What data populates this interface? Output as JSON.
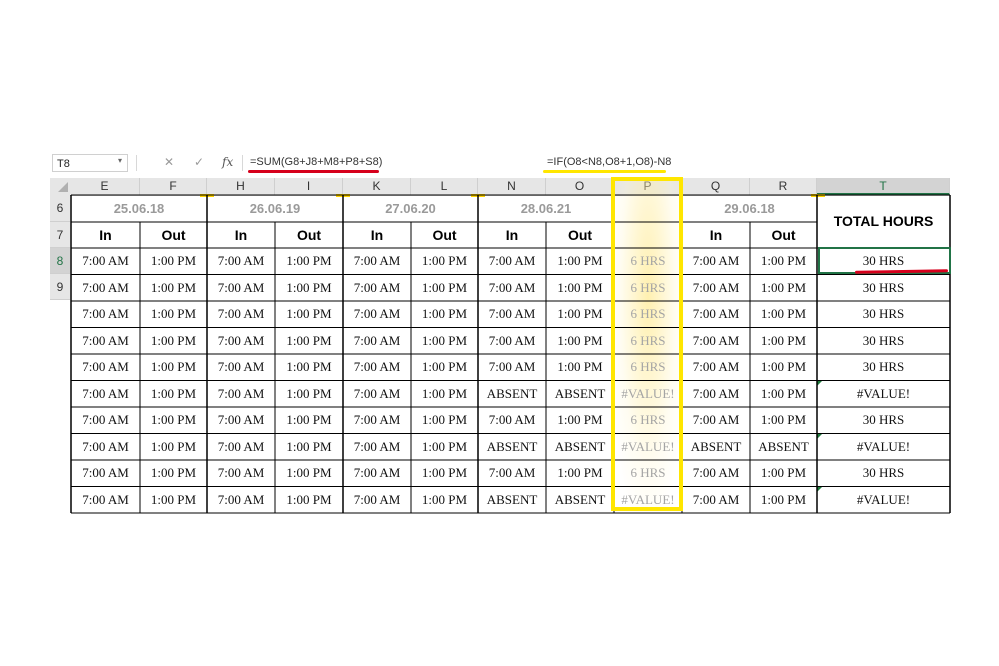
{
  "formula_bar": {
    "name_box": "T8",
    "dropdown_icon": "▾",
    "cancel_icon": "✕",
    "enter_icon": "✓",
    "fx_label": "fx",
    "formula_1": "=SUM(G8+J8+M8+P8+S8)",
    "formula_2": "=IF(O8<N8,O8+1,O8)-N8"
  },
  "column_letters": [
    "E",
    "F",
    "H",
    "I",
    "K",
    "L",
    "N",
    "O",
    "P",
    "Q",
    "R",
    "T"
  ],
  "row_numbers": [
    "6",
    "7",
    "8",
    "9"
  ],
  "dates": [
    "25.06.18",
    "26.06.19",
    "27.06.20",
    "28.06.21",
    "29.06.18"
  ],
  "in_label": "In",
  "out_label": "Out",
  "total_header": "TOTAL HOURS",
  "rows": [
    {
      "e": "7:00 AM",
      "f": "1:00 PM",
      "h": "7:00 AM",
      "i": "1:00 PM",
      "k": "7:00 AM",
      "l": "1:00 PM",
      "n": "7:00 AM",
      "o": "1:00 PM",
      "p": "6 HRS",
      "q": "7:00 AM",
      "r": "1:00 PM",
      "t": "30 HRS"
    },
    {
      "e": "7:00 AM",
      "f": "1:00 PM",
      "h": "7:00 AM",
      "i": "1:00 PM",
      "k": "7:00 AM",
      "l": "1:00 PM",
      "n": "7:00 AM",
      "o": "1:00 PM",
      "p": "6 HRS",
      "q": "7:00 AM",
      "r": "1:00 PM",
      "t": "30 HRS"
    },
    {
      "e": "7:00 AM",
      "f": "1:00 PM",
      "h": "7:00 AM",
      "i": "1:00 PM",
      "k": "7:00 AM",
      "l": "1:00 PM",
      "n": "7:00 AM",
      "o": "1:00 PM",
      "p": "6 HRS",
      "q": "7:00 AM",
      "r": "1:00 PM",
      "t": "30 HRS"
    },
    {
      "e": "7:00 AM",
      "f": "1:00 PM",
      "h": "7:00 AM",
      "i": "1:00 PM",
      "k": "7:00 AM",
      "l": "1:00 PM",
      "n": "7:00 AM",
      "o": "1:00 PM",
      "p": "6 HRS",
      "q": "7:00 AM",
      "r": "1:00 PM",
      "t": "30 HRS"
    },
    {
      "e": "7:00 AM",
      "f": "1:00 PM",
      "h": "7:00 AM",
      "i": "1:00 PM",
      "k": "7:00 AM",
      "l": "1:00 PM",
      "n": "7:00 AM",
      "o": "1:00 PM",
      "p": "6 HRS",
      "q": "7:00 AM",
      "r": "1:00 PM",
      "t": "30 HRS"
    },
    {
      "e": "7:00 AM",
      "f": "1:00 PM",
      "h": "7:00 AM",
      "i": "1:00 PM",
      "k": "7:00 AM",
      "l": "1:00 PM",
      "n": "ABSENT",
      "o": "ABSENT",
      "p": "#VALUE!",
      "q": "7:00 AM",
      "r": "1:00 PM",
      "t": "#VALUE!"
    },
    {
      "e": "7:00 AM",
      "f": "1:00 PM",
      "h": "7:00 AM",
      "i": "1:00 PM",
      "k": "7:00 AM",
      "l": "1:00 PM",
      "n": "7:00 AM",
      "o": "1:00 PM",
      "p": "6 HRS",
      "q": "7:00 AM",
      "r": "1:00 PM",
      "t": "30 HRS"
    },
    {
      "e": "7:00 AM",
      "f": "1:00 PM",
      "h": "7:00 AM",
      "i": "1:00 PM",
      "k": "7:00 AM",
      "l": "1:00 PM",
      "n": "ABSENT",
      "o": "ABSENT",
      "p": "#VALUE!",
      "q": "ABSENT",
      "r": "ABSENT",
      "t": "#VALUE!"
    },
    {
      "e": "7:00 AM",
      "f": "1:00 PM",
      "h": "7:00 AM",
      "i": "1:00 PM",
      "k": "7:00 AM",
      "l": "1:00 PM",
      "n": "7:00 AM",
      "o": "1:00 PM",
      "p": "6 HRS",
      "q": "7:00 AM",
      "r": "1:00 PM",
      "t": "30 HRS"
    },
    {
      "e": "7:00 AM",
      "f": "1:00 PM",
      "h": "7:00 AM",
      "i": "1:00 PM",
      "k": "7:00 AM",
      "l": "1:00 PM",
      "n": "ABSENT",
      "o": "ABSENT",
      "p": "#VALUE!",
      "q": "7:00 AM",
      "r": "1:00 PM",
      "t": "#VALUE!"
    }
  ],
  "colors": {
    "highlight_yellow": "#ffe600",
    "annotation_red": "#d6001c",
    "selection_green": "#217346"
  }
}
